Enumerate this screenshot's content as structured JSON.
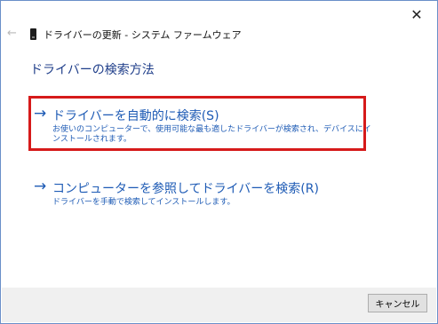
{
  "window": {
    "title": "ドライバーの更新 - システム ファームウェア",
    "close_glyph": "✕",
    "back_glyph": "←"
  },
  "page": {
    "heading": "ドライバーの検索方法"
  },
  "options": [
    {
      "arrow": "→",
      "title": "ドライバーを自動的に検索(S)",
      "description": "お使いのコンピューターで、使用可能な最も適したドライバーが検索され、デバイスにインストールされます。",
      "highlighted": true
    },
    {
      "arrow": "→",
      "title": "コンピューターを参照してドライバーを検索(R)",
      "description": "ドライバーを手動で検索してインストールします。",
      "highlighted": false
    }
  ],
  "footer": {
    "cancel_label": "キャンセル"
  },
  "colors": {
    "link_blue": "#1e5bb5",
    "heading_blue": "#1f3e8a",
    "highlight_red": "#d61a1a",
    "footer_bg": "#f0f0f0"
  },
  "icons": {
    "device": "device-icon"
  }
}
